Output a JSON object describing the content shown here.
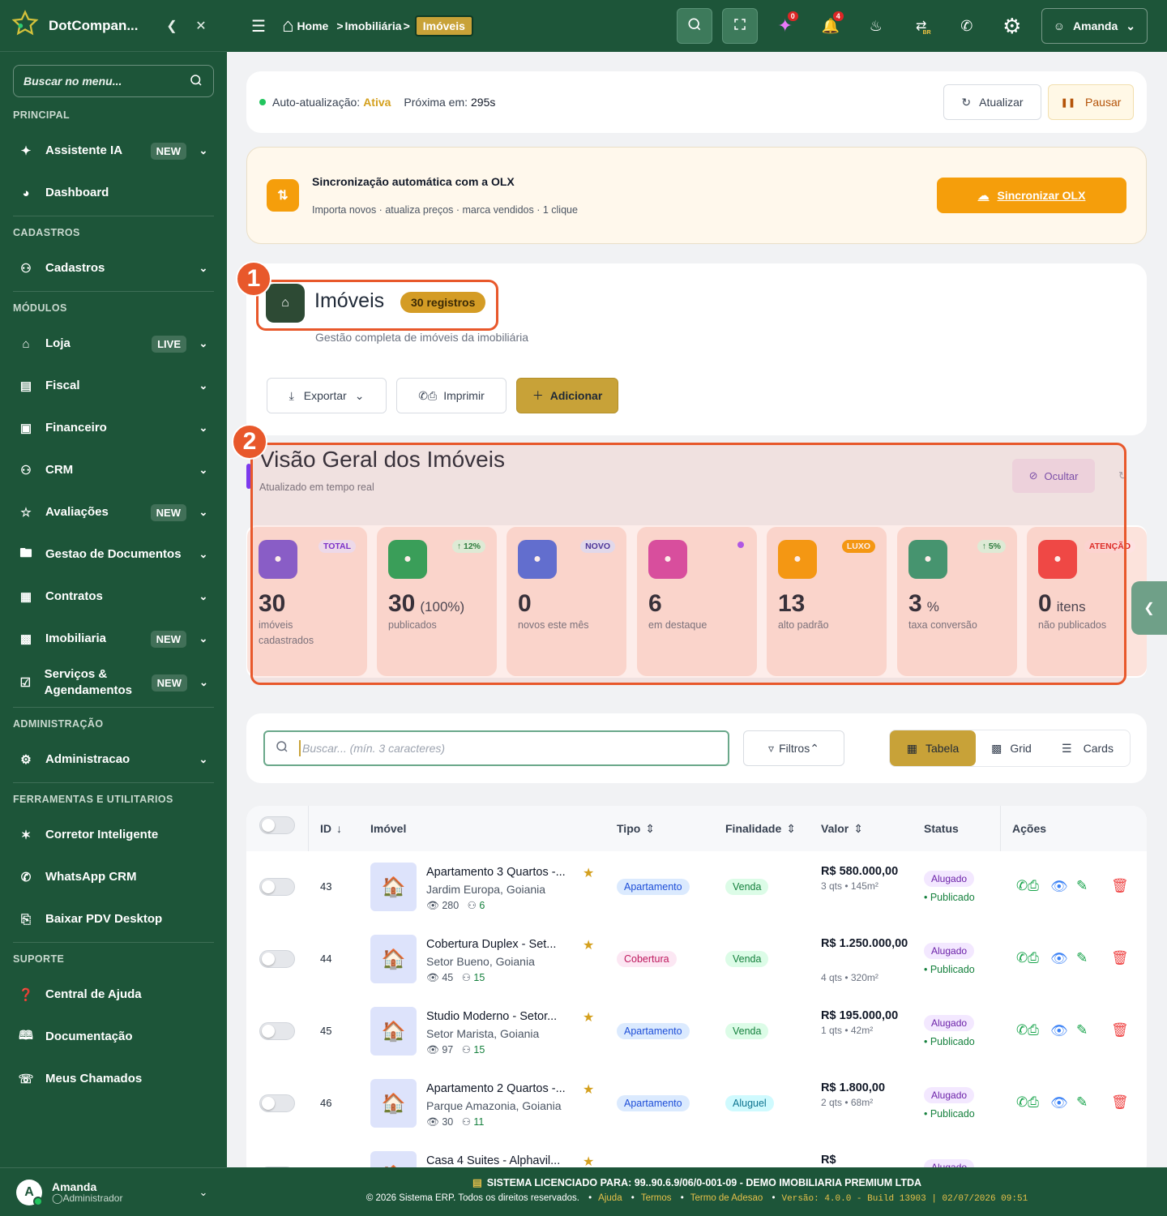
{
  "sidebar": {
    "brand": "DotCompan...",
    "collapse_icon": "chevron-left-icon",
    "close_icon": "close-icon",
    "search_placeholder": "Buscar no menu...",
    "sections": {
      "principal": "PRINCIPAL",
      "cadastros": "CADASTROS",
      "modulos": "MÓDULOS",
      "administracao": "ADMINISTRAÇÃO",
      "ferramentas": "FERRAMENTAS E UTILITARIOS",
      "suporte": "SUPORTE"
    },
    "items": {
      "assistente": {
        "label": "Assistente IA",
        "pill": "NEW"
      },
      "dashboard": {
        "label": "Dashboard"
      },
      "cadastros": {
        "label": "Cadastros"
      },
      "loja": {
        "label": "Loja",
        "pill": "LIVE"
      },
      "fiscal": {
        "label": "Fiscal"
      },
      "financeiro": {
        "label": "Financeiro"
      },
      "crm": {
        "label": "CRM"
      },
      "avaliacoes": {
        "label": "Avaliações",
        "pill": "NEW"
      },
      "documentos": {
        "label": "Gestao de Documentos"
      },
      "contratos": {
        "label": "Contratos"
      },
      "imobiliaria": {
        "label": "Imobiliaria",
        "pill": "NEW"
      },
      "servicos": {
        "label": "Serviços & Agendamentos",
        "pill": "NEW"
      },
      "administracao": {
        "label": "Administracao"
      },
      "corretor": {
        "label": "Corretor Inteligente"
      },
      "whatsapp": {
        "label": "WhatsApp CRM"
      },
      "pdv": {
        "label": "Baixar PDV Desktop"
      },
      "ajuda": {
        "label": "Central de Ajuda"
      },
      "documentacao": {
        "label": "Documentação"
      },
      "chamados": {
        "label": "Meus Chamados"
      }
    },
    "user": {
      "initial": "A",
      "name": "Amanda",
      "role": "Administrador"
    }
  },
  "topbar": {
    "breadcrumb": {
      "home": "Home",
      "sep1": ">",
      "parent": "Imobiliária",
      "sep2": ">",
      "current": "Imóveis"
    },
    "badges": {
      "ai": "0",
      "notifications": "4"
    },
    "lang": "BR",
    "user": "Amanda"
  },
  "autorefresh": {
    "label": "Auto-atualização:",
    "status": "Ativa",
    "next_label": "Próxima em:",
    "next_value": "295s",
    "refresh_btn": "Atualizar",
    "pause_btn": "Pausar"
  },
  "olx": {
    "title": "Sincronização automática com a OLX",
    "subtitle": "Importa novos · atualiza preços · marca vendidos · 1 clique",
    "button": "Sincronizar OLX"
  },
  "page": {
    "title": "Imóveis",
    "count_badge": "30 registros",
    "subtitle": "Gestão completa de imóveis da imobiliária",
    "export_btn": "Exportar",
    "print_btn": "Imprimir",
    "add_btn": "Adicionar"
  },
  "annotations": {
    "one": "1",
    "two": "2"
  },
  "overview": {
    "title": "Visão Geral dos Imóveis",
    "subtitle": "Atualizado em tempo real",
    "hide_btn": "Ocultar",
    "stats": [
      {
        "tag": "TOTAL",
        "value": "30",
        "suffix": "",
        "label1": "imóveis",
        "label2": "cadastrados",
        "color": "#7c5cd6",
        "icon": "home-icon",
        "tag_bg": "#ede9fe",
        "tag_fg": "#6d28d9"
      },
      {
        "tag": "↑ 12%",
        "value": "30",
        "suffix": "(100%)",
        "label1": "publicados",
        "label2": "",
        "color": "#22a55b",
        "icon": "check-circle-icon",
        "tag_bg": "#dcfce7",
        "tag_fg": "#15803d"
      },
      {
        "tag": "NOVO",
        "value": "0",
        "suffix": "",
        "label1": "novos este mês",
        "label2": "",
        "color": "#4f6fe0",
        "icon": "plus-circle-icon",
        "tag_bg": "#e0e7ff",
        "tag_fg": "#3730a3"
      },
      {
        "tag": "",
        "value": "6",
        "suffix": "",
        "label1": "em destaque",
        "label2": "",
        "color": "#d54aa8",
        "icon": "star-icon",
        "tag_bg": "",
        "tag_fg": ""
      },
      {
        "tag": "LUXO",
        "value": "13",
        "suffix": "",
        "label1": "alto padrão",
        "label2": "",
        "color": "#f59e0b",
        "icon": "diamond-icon",
        "tag_bg": "#f59e0b",
        "tag_fg": "#ffffff"
      },
      {
        "tag": "↑ 5%",
        "value": "3",
        "suffix": "%",
        "label1": "taxa conversão",
        "label2": "",
        "color": "#2f9a73",
        "icon": "chart-icon",
        "tag_bg": "#dcfce7",
        "tag_fg": "#15803d"
      },
      {
        "tag": "ATENÇÃO",
        "value": "0",
        "suffix": "itens",
        "label1": "não publicados",
        "label2": "",
        "color": "#ef4444",
        "icon": "warning-icon",
        "tag_bg": "#fee2e2",
        "tag_fg": "#dc2626"
      }
    ]
  },
  "search": {
    "placeholder": "Buscar... (mín. 3 caracteres)",
    "filters_btn": "Filtros",
    "views": {
      "table": "Tabela",
      "grid": "Grid",
      "cards": "Cards"
    }
  },
  "table": {
    "headers": {
      "id": "ID",
      "imovel": "Imóvel",
      "tipo": "Tipo",
      "finalidade": "Finalidade",
      "valor": "Valor",
      "status": "Status",
      "acoes": "Ações"
    },
    "rows": [
      {
        "id": "43",
        "title": "Apartamento 3 Quartos -...",
        "location": "Jardim Europa, Goiania",
        "views": "280",
        "leads": "6",
        "tipo": "Apartamento",
        "finalidade": "Venda",
        "valor": "R$ 580.000,00",
        "detail": "3 qts • 145m²",
        "status": "Alugado",
        "pub": "• Publicado"
      },
      {
        "id": "44",
        "title": "Cobertura Duplex - Set...",
        "location": "Setor Bueno, Goiania",
        "views": "45",
        "leads": "15",
        "tipo": "Cobertura",
        "finalidade": "Venda",
        "valor": "R$ 1.250.000,00",
        "detail": "4 qts • 320m²",
        "status": "Alugado",
        "pub": "• Publicado"
      },
      {
        "id": "45",
        "title": "Studio Moderno - Setor...",
        "location": "Setor Marista, Goiania",
        "views": "97",
        "leads": "15",
        "tipo": "Apartamento",
        "finalidade": "Venda",
        "valor": "R$ 195.000,00",
        "detail": "1 qts • 42m²",
        "status": "Alugado",
        "pub": "• Publicado"
      },
      {
        "id": "46",
        "title": "Apartamento 2 Quartos -...",
        "location": "Parque Amazonia, Goiania",
        "views": "30",
        "leads": "11",
        "tipo": "Apartamento",
        "finalidade": "Aluguel",
        "valor": "R$ 1.800,00",
        "detail": "2 qts • 68m²",
        "status": "Alugado",
        "pub": "• Publicado"
      },
      {
        "id": "",
        "title": "Casa 4 Suites - Alphavil...",
        "location": "",
        "views": "",
        "leads": "",
        "tipo": "",
        "finalidade": "",
        "valor": "R$",
        "detail": "",
        "status": "Alugado",
        "pub": ""
      }
    ]
  },
  "footer": {
    "license_label": "SISTEMA LICENCIADO PARA:",
    "license_value": "99..90.6.9/06/0-001-09 - DEMO IMOBILIARIA PREMIUM LTDA",
    "copyright": "© 2026 Sistema ERP. Todos os direitos reservados.",
    "links": [
      "Ajuda",
      "Termos",
      "Termo de Adesao"
    ],
    "version": "Versão: 4.0.0 - Build 13903 | 02/07/2026 09:51"
  }
}
